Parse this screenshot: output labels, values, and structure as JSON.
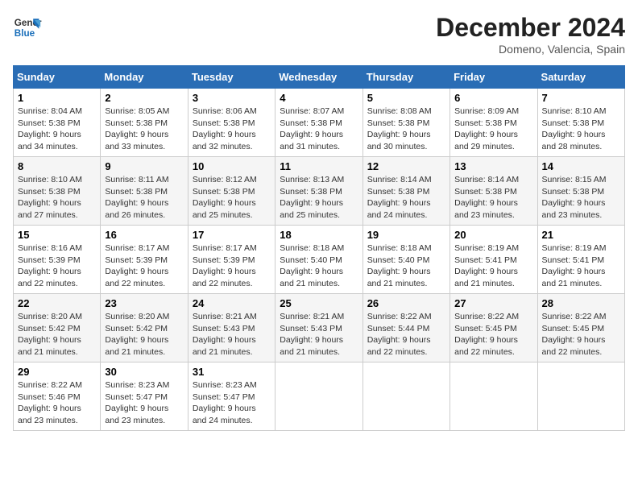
{
  "header": {
    "logo_line1": "General",
    "logo_line2": "Blue",
    "month_year": "December 2024",
    "location": "Domeno, Valencia, Spain"
  },
  "days_of_week": [
    "Sunday",
    "Monday",
    "Tuesday",
    "Wednesday",
    "Thursday",
    "Friday",
    "Saturday"
  ],
  "weeks": [
    [
      {
        "day": "1",
        "sunrise": "8:04 AM",
        "sunset": "5:38 PM",
        "daylight": "9 hours and 34 minutes."
      },
      {
        "day": "2",
        "sunrise": "8:05 AM",
        "sunset": "5:38 PM",
        "daylight": "9 hours and 33 minutes."
      },
      {
        "day": "3",
        "sunrise": "8:06 AM",
        "sunset": "5:38 PM",
        "daylight": "9 hours and 32 minutes."
      },
      {
        "day": "4",
        "sunrise": "8:07 AM",
        "sunset": "5:38 PM",
        "daylight": "9 hours and 31 minutes."
      },
      {
        "day": "5",
        "sunrise": "8:08 AM",
        "sunset": "5:38 PM",
        "daylight": "9 hours and 30 minutes."
      },
      {
        "day": "6",
        "sunrise": "8:09 AM",
        "sunset": "5:38 PM",
        "daylight": "9 hours and 29 minutes."
      },
      {
        "day": "7",
        "sunrise": "8:10 AM",
        "sunset": "5:38 PM",
        "daylight": "9 hours and 28 minutes."
      }
    ],
    [
      {
        "day": "8",
        "sunrise": "8:10 AM",
        "sunset": "5:38 PM",
        "daylight": "9 hours and 27 minutes."
      },
      {
        "day": "9",
        "sunrise": "8:11 AM",
        "sunset": "5:38 PM",
        "daylight": "9 hours and 26 minutes."
      },
      {
        "day": "10",
        "sunrise": "8:12 AM",
        "sunset": "5:38 PM",
        "daylight": "9 hours and 25 minutes."
      },
      {
        "day": "11",
        "sunrise": "8:13 AM",
        "sunset": "5:38 PM",
        "daylight": "9 hours and 25 minutes."
      },
      {
        "day": "12",
        "sunrise": "8:14 AM",
        "sunset": "5:38 PM",
        "daylight": "9 hours and 24 minutes."
      },
      {
        "day": "13",
        "sunrise": "8:14 AM",
        "sunset": "5:38 PM",
        "daylight": "9 hours and 23 minutes."
      },
      {
        "day": "14",
        "sunrise": "8:15 AM",
        "sunset": "5:38 PM",
        "daylight": "9 hours and 23 minutes."
      }
    ],
    [
      {
        "day": "15",
        "sunrise": "8:16 AM",
        "sunset": "5:39 PM",
        "daylight": "9 hours and 22 minutes."
      },
      {
        "day": "16",
        "sunrise": "8:17 AM",
        "sunset": "5:39 PM",
        "daylight": "9 hours and 22 minutes."
      },
      {
        "day": "17",
        "sunrise": "8:17 AM",
        "sunset": "5:39 PM",
        "daylight": "9 hours and 22 minutes."
      },
      {
        "day": "18",
        "sunrise": "8:18 AM",
        "sunset": "5:40 PM",
        "daylight": "9 hours and 21 minutes."
      },
      {
        "day": "19",
        "sunrise": "8:18 AM",
        "sunset": "5:40 PM",
        "daylight": "9 hours and 21 minutes."
      },
      {
        "day": "20",
        "sunrise": "8:19 AM",
        "sunset": "5:41 PM",
        "daylight": "9 hours and 21 minutes."
      },
      {
        "day": "21",
        "sunrise": "8:19 AM",
        "sunset": "5:41 PM",
        "daylight": "9 hours and 21 minutes."
      }
    ],
    [
      {
        "day": "22",
        "sunrise": "8:20 AM",
        "sunset": "5:42 PM",
        "daylight": "9 hours and 21 minutes."
      },
      {
        "day": "23",
        "sunrise": "8:20 AM",
        "sunset": "5:42 PM",
        "daylight": "9 hours and 21 minutes."
      },
      {
        "day": "24",
        "sunrise": "8:21 AM",
        "sunset": "5:43 PM",
        "daylight": "9 hours and 21 minutes."
      },
      {
        "day": "25",
        "sunrise": "8:21 AM",
        "sunset": "5:43 PM",
        "daylight": "9 hours and 21 minutes."
      },
      {
        "day": "26",
        "sunrise": "8:22 AM",
        "sunset": "5:44 PM",
        "daylight": "9 hours and 22 minutes."
      },
      {
        "day": "27",
        "sunrise": "8:22 AM",
        "sunset": "5:45 PM",
        "daylight": "9 hours and 22 minutes."
      },
      {
        "day": "28",
        "sunrise": "8:22 AM",
        "sunset": "5:45 PM",
        "daylight": "9 hours and 22 minutes."
      }
    ],
    [
      {
        "day": "29",
        "sunrise": "8:22 AM",
        "sunset": "5:46 PM",
        "daylight": "9 hours and 23 minutes."
      },
      {
        "day": "30",
        "sunrise": "8:23 AM",
        "sunset": "5:47 PM",
        "daylight": "9 hours and 23 minutes."
      },
      {
        "day": "31",
        "sunrise": "8:23 AM",
        "sunset": "5:47 PM",
        "daylight": "9 hours and 24 minutes."
      },
      null,
      null,
      null,
      null
    ]
  ]
}
